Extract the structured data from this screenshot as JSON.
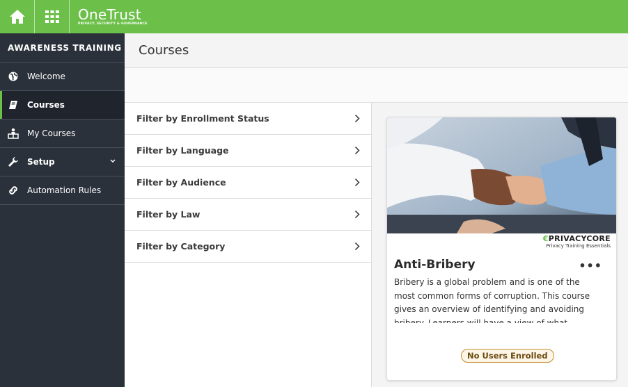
{
  "app": {
    "logo_main": "OneTrust",
    "logo_sub": "PRIVACY, SECURITY & GOVERNANCE",
    "accent": "#6cc04a"
  },
  "topbar": {
    "home_icon": "home-icon",
    "apps_icon": "grid-icon"
  },
  "sidebar": {
    "title": "AWARENESS TRAINING",
    "items": [
      {
        "label": "Welcome",
        "icon": "globe-icon"
      },
      {
        "label": "Courses",
        "icon": "book-icon",
        "active": true
      },
      {
        "label": "My Courses",
        "icon": "person-desk-icon"
      },
      {
        "label": "Setup",
        "icon": "wrench-icon",
        "expandable": true
      },
      {
        "label": "Automation Rules",
        "icon": "link-icon"
      }
    ]
  },
  "page": {
    "title": "Courses"
  },
  "filters": [
    {
      "label": "Filter by Enrollment Status"
    },
    {
      "label": "Filter by Language"
    },
    {
      "label": "Filter by Audience"
    },
    {
      "label": "Filter by Law"
    },
    {
      "label": "Filter by Category"
    }
  ],
  "course_card": {
    "brand_main_prefix": "€",
    "brand_main": "PRIVACYCORE",
    "brand_sub": "Privacy Training Essentials",
    "title": "Anti-Bribery",
    "more": "•••",
    "description": " Bribery is a global problem and is one of the most common forms of corruption. This course gives an overview of identifying and avoiding bribery. Learners will have a view of what activities",
    "status": "No Users Enrolled"
  }
}
